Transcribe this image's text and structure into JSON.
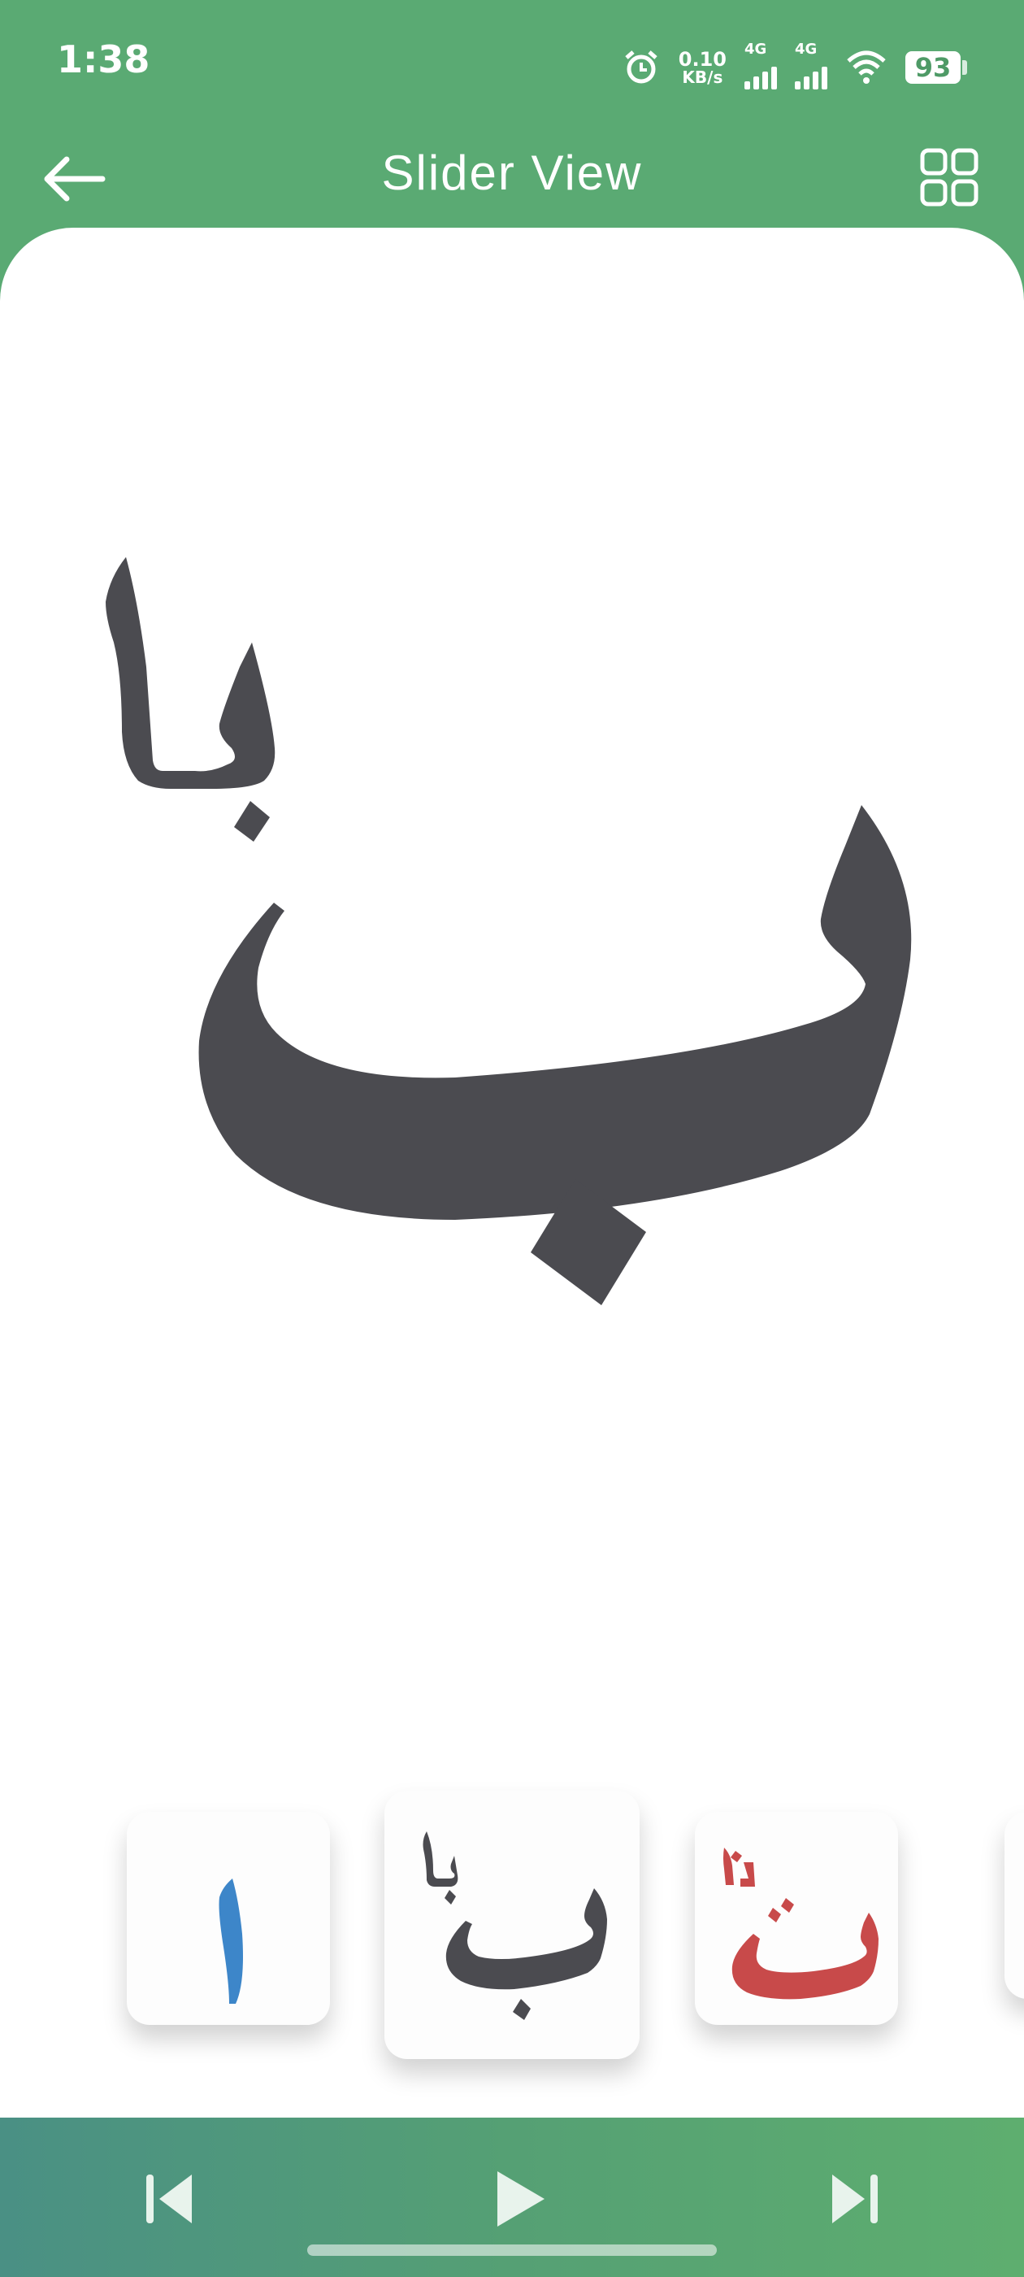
{
  "status_bar": {
    "time": "1:38",
    "net_speed_value": "0.10",
    "net_speed_unit": "KB/s",
    "sim1_label": "4G",
    "sim2_label": "4G",
    "battery": "93",
    "icons": [
      "alarm-icon",
      "signal-icon",
      "signal-icon",
      "wifi-icon",
      "battery-icon"
    ]
  },
  "app_bar": {
    "title": "Slider View",
    "back_icon": "arrow-left-icon",
    "grid_icon": "grid-view-icon"
  },
  "current_letter": {
    "name": "ba",
    "label": "با",
    "color": "#4b4b50"
  },
  "carousel": {
    "items": [
      {
        "name": "alif",
        "label": "ا",
        "color": "#3d86c9"
      },
      {
        "name": "ba",
        "label": "با",
        "color": "#4b4b50",
        "selected": true
      },
      {
        "name": "ta",
        "label": "تا",
        "color": "#c84a4a"
      }
    ]
  },
  "controls": {
    "prev_icon": "skip-previous-icon",
    "play_icon": "play-icon",
    "next_icon": "skip-next-icon"
  },
  "colors": {
    "header_green": "#5aaa73",
    "letter_dark": "#4b4b50"
  }
}
